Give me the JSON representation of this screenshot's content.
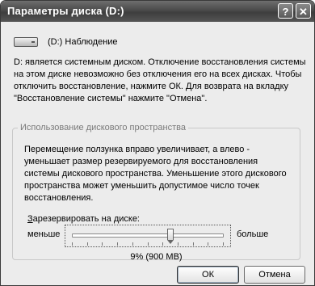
{
  "window": {
    "title": "Параметры диска (D:)",
    "help_glyph": "?",
    "close_glyph": "✕"
  },
  "drive": {
    "icon": "hard-drive-icon",
    "label": "(D:)  Наблюдение"
  },
  "description": "D: является системным диском. Отключение восстановления системы на этом диске невозможно без отключения его на всех дисках. Чтобы отключить восстановление, нажмите ОК. Для возврата на вкладку \"Восстановление системы\" нажмите \"Отмена\".",
  "disk_usage": {
    "group_title": "Использование дискового пространства",
    "explanation": "Перемещение ползунка вправо увеличивает, а влево - уменьшает размер резервируемого для восстановления системы дискового пространства. Уменьшение этого дискового пространства может уменьшить допустимое число точек восстановления.",
    "reserve_label": "Зарезервировать на диске:",
    "reserve_label_accel": "З",
    "reserve_label_rest": "арезервировать на диске:",
    "less_label": "меньше",
    "more_label": "больше",
    "slider_fraction": 0.65,
    "value_text": "9% (900 MB)"
  },
  "buttons": {
    "ok": "ОК",
    "cancel": "Отмена"
  }
}
